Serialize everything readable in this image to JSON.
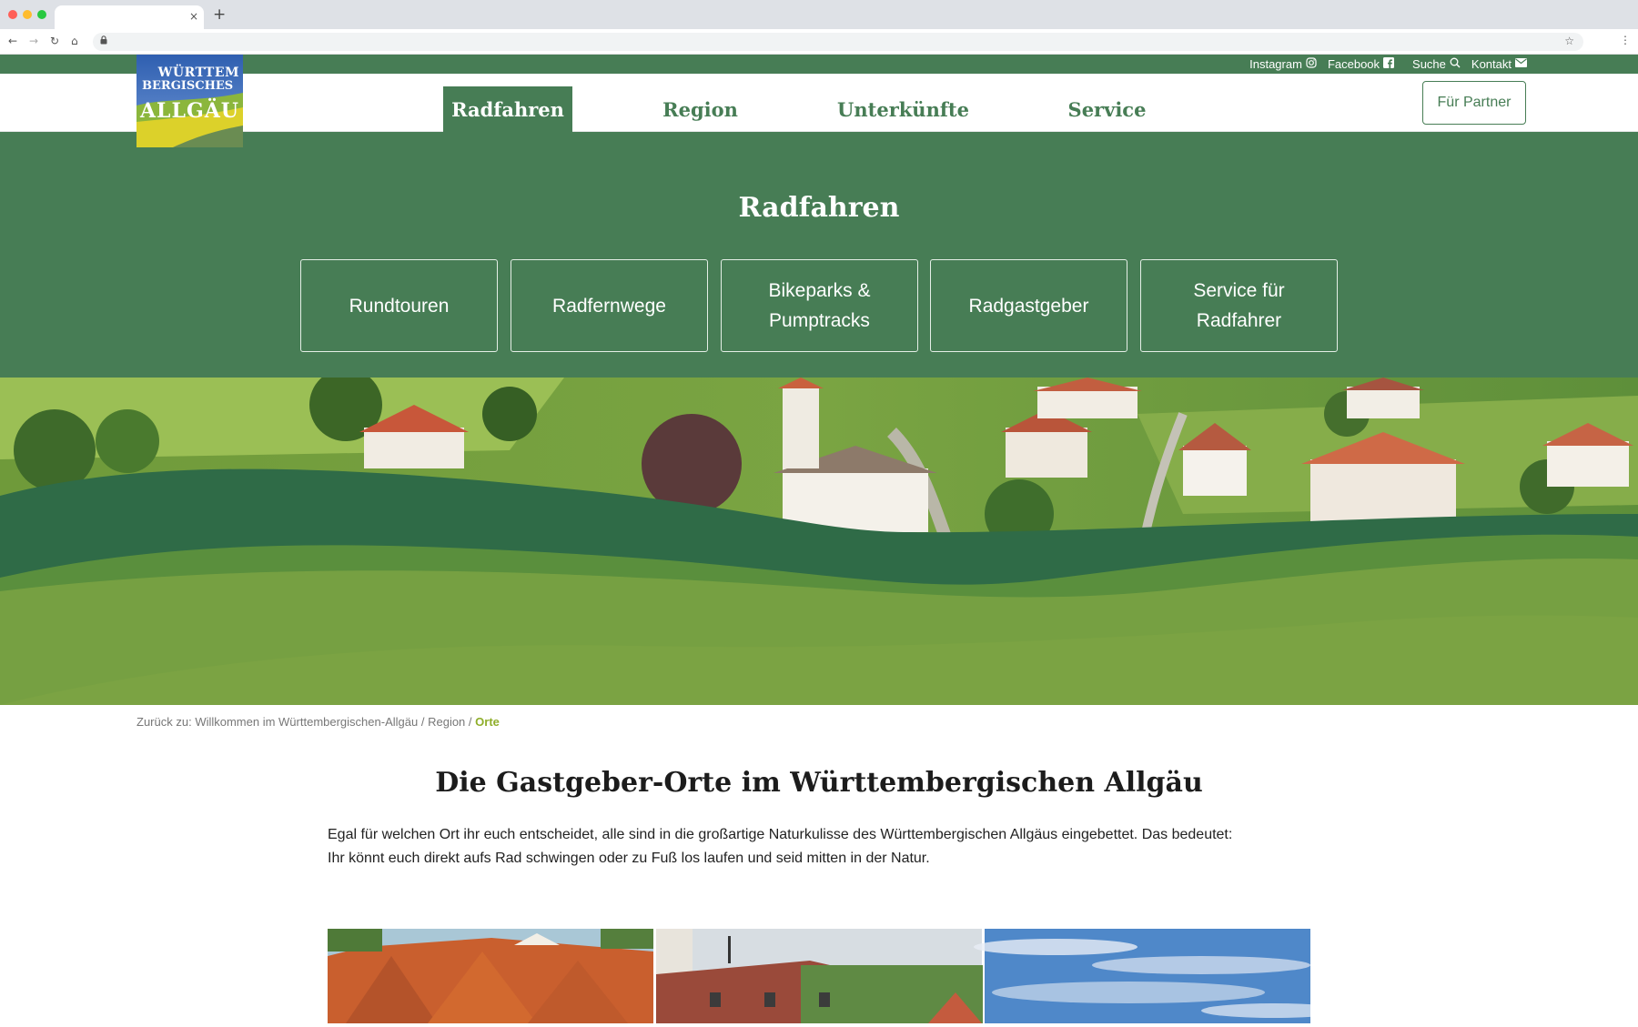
{
  "browser": {
    "tab_close": "×",
    "new_tab": "+",
    "back": "←",
    "forward": "→",
    "reload": "↻",
    "home": "⌂",
    "lock": "🔒",
    "bookmark": "☆",
    "menu": "⋮"
  },
  "topbar": {
    "instagram": "Instagram",
    "facebook": "Facebook",
    "search": "Suche",
    "contact": "Kontakt"
  },
  "logo": {
    "line1": "WÜRTTEM",
    "line2": "BERGISCHES",
    "line3": "ALLGÄU"
  },
  "nav": {
    "items": [
      {
        "label": "Radfahren",
        "active": true
      },
      {
        "label": "Region",
        "active": false
      },
      {
        "label": "Unterkünfte",
        "active": false
      },
      {
        "label": "Service",
        "active": false
      }
    ],
    "partner_button": "Für Partner"
  },
  "submenu": {
    "title": "Radfahren",
    "cards": [
      {
        "line1": "Rundtouren",
        "line2": ""
      },
      {
        "line1": "Radfernwege",
        "line2": ""
      },
      {
        "line1": "Bikeparks &",
        "line2": "Pumptracks"
      },
      {
        "line1": "Radgastgeber",
        "line2": ""
      },
      {
        "line1": "Service für",
        "line2": "Radfahrer"
      }
    ]
  },
  "breadcrumb": {
    "prefix": "Zurück zu:",
    "items": [
      "Willkommen im Württembergischen-Allgäu",
      "Region"
    ],
    "current": "Orte",
    "separator": "/"
  },
  "content": {
    "title": "Die Gastgeber-Orte im Württembergischen Allgäu",
    "intro_line1": "Egal für welchen Ort ihr euch entscheidet, alle sind in die großartige Naturkulisse des Württembergischen Allgäus eingebettet. Das bedeutet:",
    "intro_line2": "Ihr könnt euch direkt aufs Rad schwingen oder zu Fuß los laufen und seid mitten in der Natur."
  },
  "colors": {
    "brand_green": "#477d55",
    "wave_dark": "#2f6b47",
    "wave_light": "#7ba343",
    "breadcrumb_current": "#8fae2a"
  }
}
